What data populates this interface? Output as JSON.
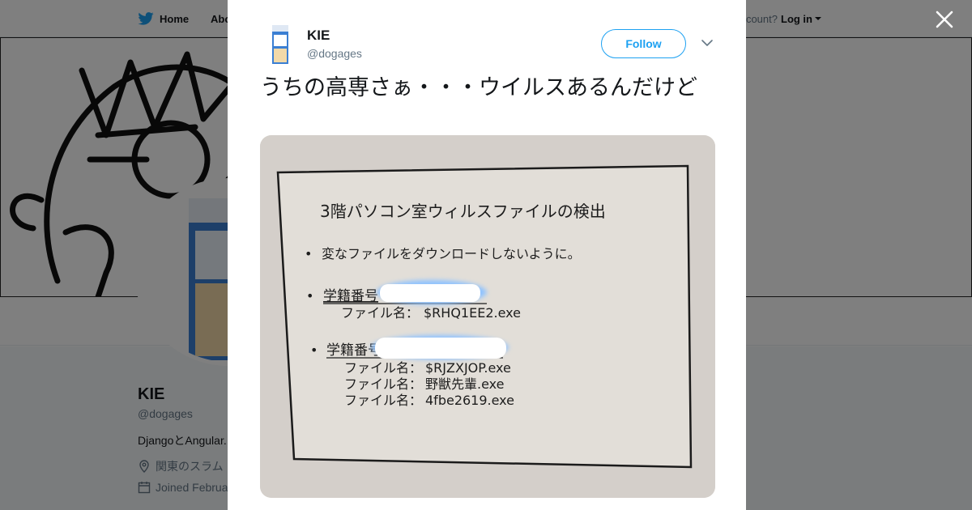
{
  "nav": {
    "home": "Home",
    "about": "Abo",
    "account_prompt": "ccount?",
    "login": "Log in"
  },
  "profile": {
    "name": "KIE",
    "handle": "@dogages",
    "bio": "DjangoとAngular.",
    "location": "関東のスラム",
    "joined": "Joined Februa"
  },
  "tweet": {
    "author_name": "KIE",
    "author_handle": "@dogages",
    "follow_label": "Follow",
    "text": "うちの高専さぁ・・・ウイルスあるんだけど"
  },
  "photo": {
    "title": "3階パソコン室ウィルスファイルの検出",
    "bullet1": "変なファイルをダウンロードしないように。",
    "student_label": "学籍番号",
    "file_label": "ファイル名：",
    "group1_files": [
      "$RHQ1EE2.exe"
    ],
    "group2_files": [
      "$RJZXJOP.exe",
      "野獣先輩.exe",
      "4fbe2619.exe"
    ]
  },
  "colors": {
    "accent": "#1da1f2",
    "text": "#14171a",
    "muted": "#657786",
    "overlay": "rgba(0,0,0,0.5)"
  },
  "icons": {
    "nav_home": "twitter-bird-icon",
    "close": "close-icon",
    "menu": "chevron-down-icon",
    "location": "location-pin-icon",
    "calendar": "calendar-icon"
  }
}
